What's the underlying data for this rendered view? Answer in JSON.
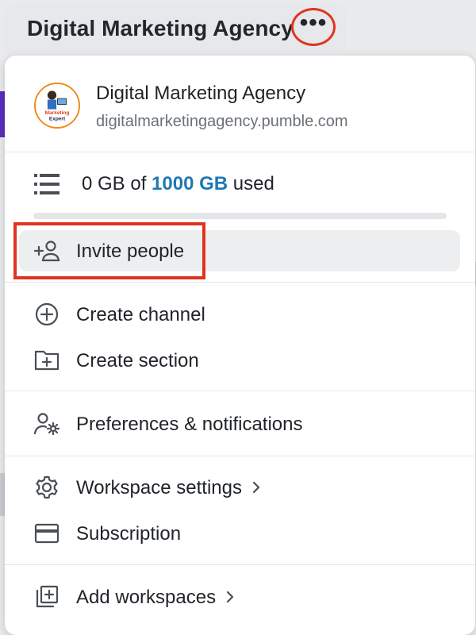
{
  "header": {
    "workspace_title": "Digital Marketing Agency",
    "more_icon": "more-horizontal-icon",
    "more_label": "•••"
  },
  "workspace": {
    "name": "Digital Marketing Agency",
    "url": "digitalmarketingagency.pumble.com",
    "logo_text": [
      "Marketing",
      "Expert"
    ]
  },
  "storage": {
    "used_prefix": "0 GB of",
    "total": "1000 GB",
    "used_suffix": "used",
    "used_fraction": 0
  },
  "menu": {
    "invite": "Invite people",
    "create_channel": "Create channel",
    "create_section": "Create section",
    "preferences": "Preferences & notifications",
    "workspace_settings": "Workspace settings",
    "subscription": "Subscription",
    "add_workspaces": "Add workspaces"
  },
  "colors": {
    "accent_blue": "#1f78b4",
    "highlight_red": "#e0341e",
    "hover_bg": "#eceef0"
  }
}
